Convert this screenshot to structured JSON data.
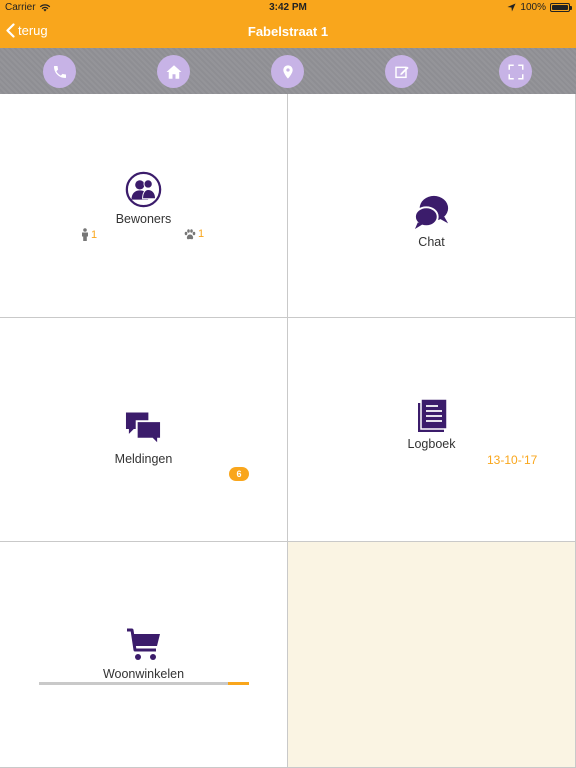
{
  "status": {
    "carrier": "Carrier",
    "time": "3:42 PM",
    "battery": "100%"
  },
  "nav": {
    "back_label": "terug",
    "title": "Fabelstraat 1"
  },
  "toolbar": {
    "buttons": [
      "phone-icon",
      "home-icon",
      "location-pin-icon",
      "edit-icon",
      "fullscreen-icon"
    ]
  },
  "tiles": {
    "bewoners": {
      "label": "Bewoners",
      "residents_count": "1",
      "pets_count": "1"
    },
    "chat": {
      "label": "Chat"
    },
    "meldingen": {
      "label": "Meldingen",
      "badge": "6"
    },
    "logboek": {
      "label": "Logboek",
      "date": "13-10-'17"
    },
    "woonwinkelen": {
      "label": "Woonwinkelen",
      "progress": 0.1
    }
  },
  "colors": {
    "accent": "#f9a61c",
    "icon": "#3b1c6b",
    "toolbar_button": "#c7b3e6",
    "empty_tile": "#faf4e3"
  }
}
